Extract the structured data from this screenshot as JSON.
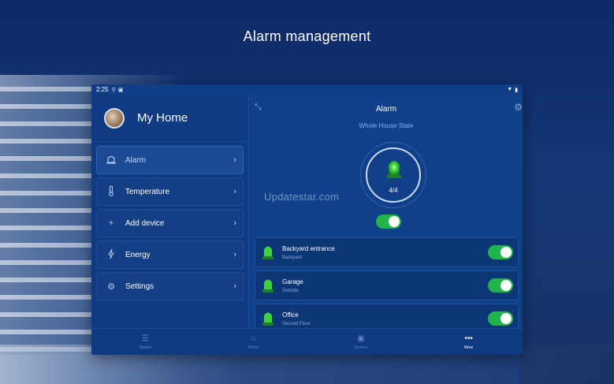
{
  "headline": "Alarm management",
  "status_bar": {
    "time": "2:25",
    "left_icons": [
      "location-icon",
      "image-icon"
    ],
    "right_icons": [
      "wifi-icon",
      "battery-icon"
    ]
  },
  "sidebar": {
    "profile_name": "My Home",
    "items": [
      {
        "label": "Alarm",
        "icon": "siren-outline-icon",
        "active": true
      },
      {
        "label": "Temperature",
        "icon": "thermometer-icon",
        "active": false
      },
      {
        "label": "Add device",
        "icon": "plus-icon",
        "active": false
      },
      {
        "label": "Energy",
        "icon": "lightning-icon",
        "active": false
      },
      {
        "label": "Settings",
        "icon": "gear-icon",
        "active": false
      }
    ]
  },
  "main": {
    "title": "Alarm",
    "subtitle": "Whole House State",
    "count": "4/4",
    "master_toggle_on": true,
    "devices": [
      {
        "name": "Backyard entrance",
        "location": "Backyard",
        "on": true
      },
      {
        "name": "Garage",
        "location": "Outside",
        "on": true
      },
      {
        "name": "Office",
        "location": "Second Floor",
        "on": true
      }
    ]
  },
  "watermark": "Updatestar.com",
  "tabbar": {
    "tabs": [
      {
        "label": "Update",
        "icon": "list-star-icon",
        "active": false
      },
      {
        "label": "Home",
        "icon": "home-icon",
        "active": false
      },
      {
        "label": "Scenes",
        "icon": "play-box-icon",
        "active": false
      },
      {
        "label": "More",
        "icon": "dots-icon",
        "active": true
      }
    ]
  },
  "colors": {
    "accent_green": "#22b34a",
    "panel_blue": "#0f3d86",
    "subtitle_blue": "#7fb0ff"
  }
}
